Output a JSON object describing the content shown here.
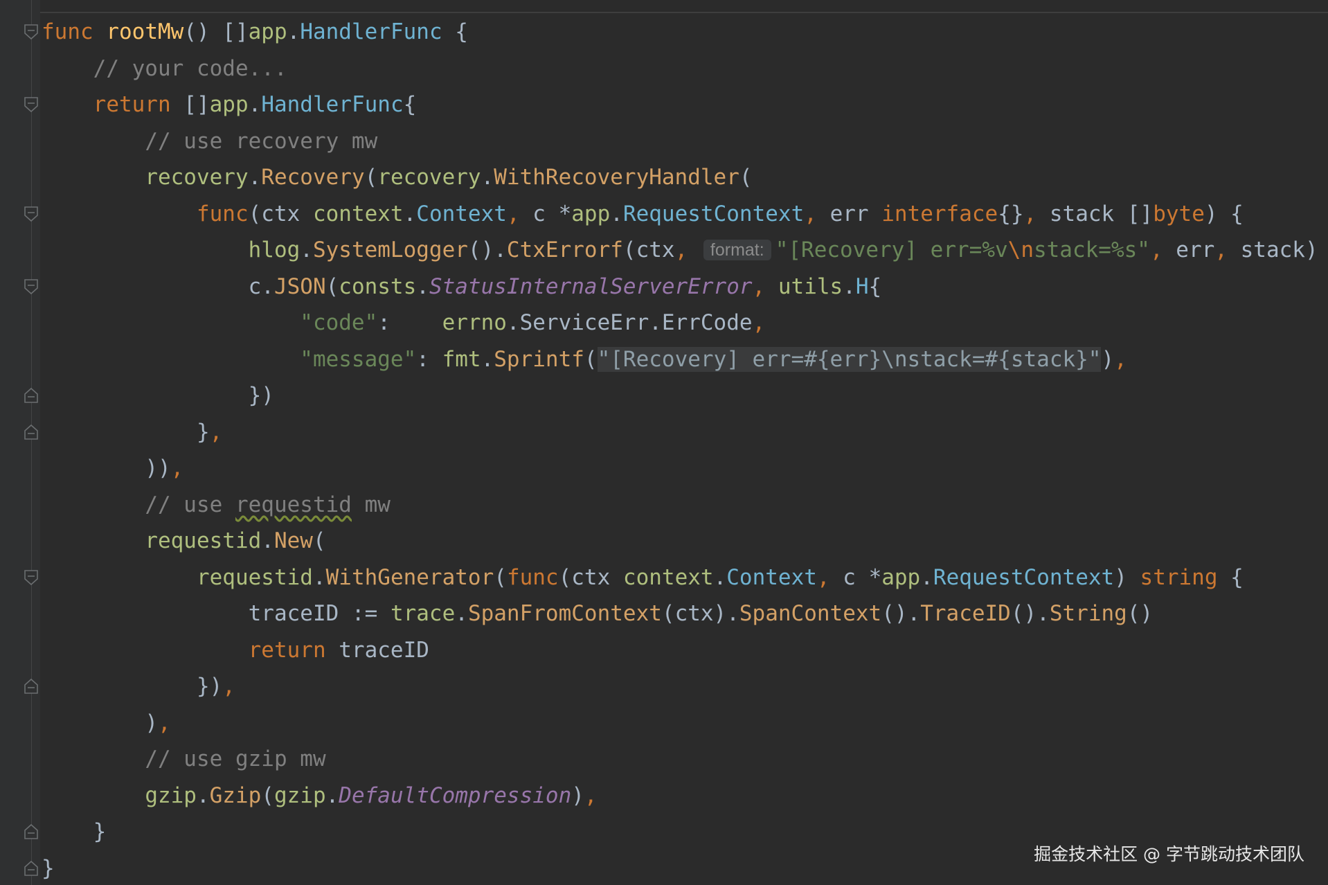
{
  "editor": {
    "lines": [
      {
        "fold": "open",
        "tokens": [
          {
            "t": "func",
            "c": "kw"
          },
          {
            "t": " "
          },
          {
            "t": "rootMw",
            "c": "fn"
          },
          {
            "t": "() []"
          },
          {
            "t": "app",
            "c": "pkg"
          },
          {
            "t": "."
          },
          {
            "t": "HandlerFunc",
            "c": "type"
          },
          {
            "t": " {"
          }
        ]
      },
      {
        "indent": 1,
        "tokens": [
          {
            "t": "// your code...",
            "c": "com"
          }
        ]
      },
      {
        "indent": 1,
        "fold": "open",
        "tokens": [
          {
            "t": "return",
            "c": "kw"
          },
          {
            "t": " []"
          },
          {
            "t": "app",
            "c": "pkg"
          },
          {
            "t": "."
          },
          {
            "t": "HandlerFunc",
            "c": "type"
          },
          {
            "t": "{"
          }
        ]
      },
      {
        "indent": 2,
        "tokens": [
          {
            "t": "// use recovery mw",
            "c": "com"
          }
        ]
      },
      {
        "indent": 2,
        "tokens": [
          {
            "t": "recovery",
            "c": "pkg"
          },
          {
            "t": "."
          },
          {
            "t": "Recovery",
            "c": "call"
          },
          {
            "t": "("
          },
          {
            "t": "recovery",
            "c": "pkg"
          },
          {
            "t": "."
          },
          {
            "t": "WithRecoveryHandler",
            "c": "call"
          },
          {
            "t": "("
          }
        ]
      },
      {
        "indent": 3,
        "fold": "open",
        "tokens": [
          {
            "t": "func",
            "c": "kw"
          },
          {
            "t": "(ctx "
          },
          {
            "t": "context",
            "c": "pkg"
          },
          {
            "t": "."
          },
          {
            "t": "Context",
            "c": "type"
          },
          {
            "t": ",",
            "c": "kw"
          },
          {
            "t": " c *"
          },
          {
            "t": "app",
            "c": "pkg"
          },
          {
            "t": "."
          },
          {
            "t": "RequestContext",
            "c": "type"
          },
          {
            "t": ",",
            "c": "kw"
          },
          {
            "t": " err "
          },
          {
            "t": "interface",
            "c": "kw"
          },
          {
            "t": "{}"
          },
          {
            "t": ",",
            "c": "kw"
          },
          {
            "t": " stack []"
          },
          {
            "t": "byte",
            "c": "kw"
          },
          {
            "t": ") {"
          }
        ]
      },
      {
        "indent": 4,
        "tokens": [
          {
            "t": "hlog",
            "c": "pkg"
          },
          {
            "t": "."
          },
          {
            "t": "SystemLogger",
            "c": "call"
          },
          {
            "t": "()."
          },
          {
            "t": "CtxErrorf",
            "c": "call"
          },
          {
            "t": "(ctx"
          },
          {
            "t": ",",
            "c": "kw"
          },
          {
            "t": " "
          },
          {
            "t": "format:",
            "c": "hint"
          },
          {
            "t": "\"[Recovery] err=%v",
            "c": "str"
          },
          {
            "t": "\\n",
            "c": "esc"
          },
          {
            "t": "stack=%s\"",
            "c": "str"
          },
          {
            "t": ",",
            "c": "kw"
          },
          {
            "t": " err"
          },
          {
            "t": ",",
            "c": "kw"
          },
          {
            "t": " stack)"
          }
        ]
      },
      {
        "indent": 4,
        "fold": "open",
        "tokens": [
          {
            "t": "c."
          },
          {
            "t": "JSON",
            "c": "call"
          },
          {
            "t": "("
          },
          {
            "t": "consts",
            "c": "pkg"
          },
          {
            "t": "."
          },
          {
            "t": "StatusInternalServerError",
            "c": "const"
          },
          {
            "t": ",",
            "c": "kw"
          },
          {
            "t": " "
          },
          {
            "t": "utils",
            "c": "pkg"
          },
          {
            "t": "."
          },
          {
            "t": "H",
            "c": "type"
          },
          {
            "t": "{"
          }
        ]
      },
      {
        "indent": 5,
        "tokens": [
          {
            "t": "\"code\"",
            "c": "str"
          },
          {
            "t": ":    "
          },
          {
            "t": "errno",
            "c": "pkg"
          },
          {
            "t": "."
          },
          {
            "t": "ServiceErr",
            "c": "fld"
          },
          {
            "t": "."
          },
          {
            "t": "ErrCode",
            "c": "fld"
          },
          {
            "t": ",",
            "c": "kw"
          }
        ]
      },
      {
        "indent": 5,
        "tokens": [
          {
            "t": "\"message\"",
            "c": "str"
          },
          {
            "t": ": "
          },
          {
            "t": "fmt",
            "c": "pkg"
          },
          {
            "t": "."
          },
          {
            "t": "Sprintf",
            "c": "call"
          },
          {
            "t": "("
          },
          {
            "t": "\"[Recovery] err=#{err}\\nstack=#{stack}\"",
            "c": "hl"
          },
          {
            "t": ")"
          },
          {
            "t": ",",
            "c": "kw"
          }
        ]
      },
      {
        "indent": 4,
        "fold": "close",
        "tokens": [
          {
            "t": "})"
          }
        ]
      },
      {
        "indent": 3,
        "fold": "close",
        "tokens": [
          {
            "t": "}"
          },
          {
            "t": ",",
            "c": "kw"
          }
        ]
      },
      {
        "indent": 2,
        "tokens": [
          {
            "t": "))"
          },
          {
            "t": ",",
            "c": "kw"
          }
        ]
      },
      {
        "indent": 2,
        "tokens": [
          {
            "t": "// use ",
            "c": "com"
          },
          {
            "t": "requestid",
            "c": "com wavy"
          },
          {
            "t": " mw",
            "c": "com"
          }
        ]
      },
      {
        "indent": 2,
        "tokens": [
          {
            "t": "requestid",
            "c": "pkg"
          },
          {
            "t": "."
          },
          {
            "t": "New",
            "c": "call"
          },
          {
            "t": "("
          }
        ]
      },
      {
        "indent": 3,
        "fold": "open",
        "tokens": [
          {
            "t": "requestid",
            "c": "pkg"
          },
          {
            "t": "."
          },
          {
            "t": "WithGenerator",
            "c": "call"
          },
          {
            "t": "("
          },
          {
            "t": "func",
            "c": "kw"
          },
          {
            "t": "(ctx "
          },
          {
            "t": "context",
            "c": "pkg"
          },
          {
            "t": "."
          },
          {
            "t": "Context",
            "c": "type"
          },
          {
            "t": ",",
            "c": "kw"
          },
          {
            "t": " c *"
          },
          {
            "t": "app",
            "c": "pkg"
          },
          {
            "t": "."
          },
          {
            "t": "RequestContext",
            "c": "type"
          },
          {
            "t": ") "
          },
          {
            "t": "string",
            "c": "kw"
          },
          {
            "t": " {"
          }
        ]
      },
      {
        "indent": 4,
        "tokens": [
          {
            "t": "traceID := "
          },
          {
            "t": "trace",
            "c": "pkg"
          },
          {
            "t": "."
          },
          {
            "t": "SpanFromContext",
            "c": "call"
          },
          {
            "t": "(ctx)."
          },
          {
            "t": "SpanContext",
            "c": "call"
          },
          {
            "t": "()."
          },
          {
            "t": "TraceID",
            "c": "call"
          },
          {
            "t": "()."
          },
          {
            "t": "String",
            "c": "call"
          },
          {
            "t": "()"
          }
        ]
      },
      {
        "indent": 4,
        "tokens": [
          {
            "t": "return",
            "c": "kw"
          },
          {
            "t": " traceID"
          }
        ]
      },
      {
        "indent": 3,
        "fold": "close",
        "tokens": [
          {
            "t": "})"
          },
          {
            "t": ",",
            "c": "kw"
          }
        ]
      },
      {
        "indent": 2,
        "tokens": [
          {
            "t": ")"
          },
          {
            "t": ",",
            "c": "kw"
          }
        ]
      },
      {
        "indent": 2,
        "tokens": [
          {
            "t": "// use gzip mw",
            "c": "com"
          }
        ]
      },
      {
        "indent": 2,
        "tokens": [
          {
            "t": "gzip",
            "c": "pkg"
          },
          {
            "t": "."
          },
          {
            "t": "Gzip",
            "c": "call"
          },
          {
            "t": "("
          },
          {
            "t": "gzip",
            "c": "pkg"
          },
          {
            "t": "."
          },
          {
            "t": "DefaultCompression",
            "c": "const"
          },
          {
            "t": ")"
          },
          {
            "t": ",",
            "c": "kw"
          }
        ]
      },
      {
        "indent": 1,
        "fold": "close",
        "tokens": [
          {
            "t": "}"
          }
        ]
      },
      {
        "fold": "close",
        "tokens": [
          {
            "t": "}"
          }
        ]
      }
    ]
  },
  "watermark": "掘金技术社区 @ 字节跳动技术团队",
  "colors": {
    "background": "#2b2b2b",
    "keyword": "#cc7832",
    "function_name": "#ffc66d",
    "comment": "#808080",
    "string": "#6a8759",
    "package": "#afbf7e",
    "type": "#6fb3d2",
    "constant": "#9876aa"
  }
}
